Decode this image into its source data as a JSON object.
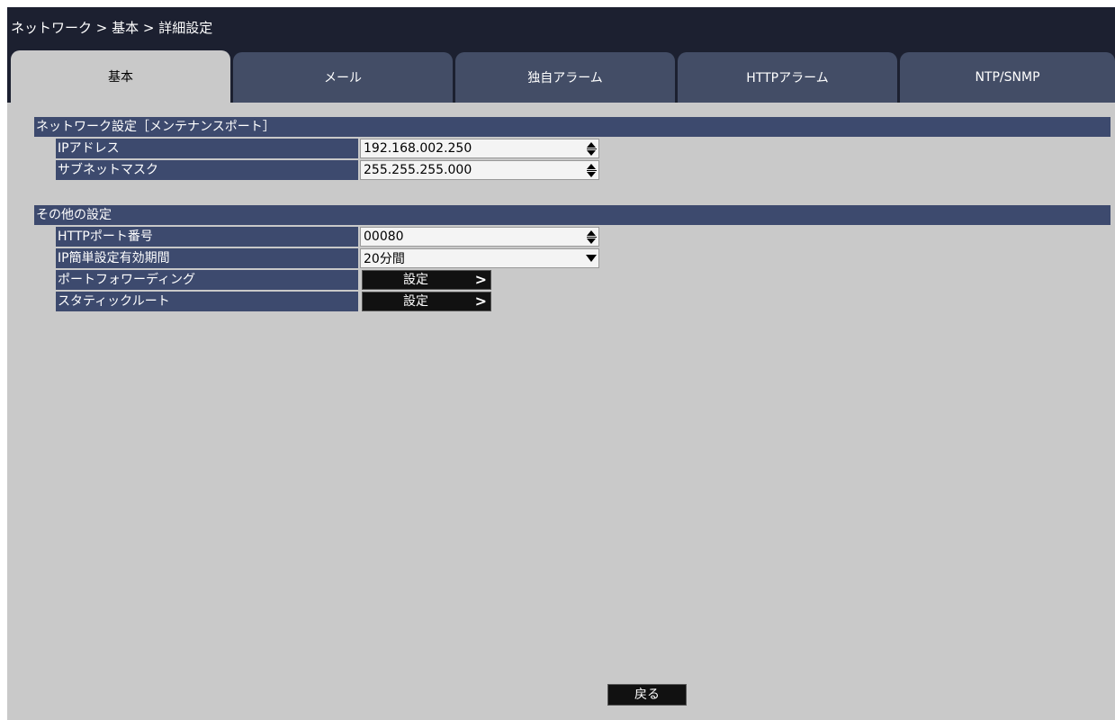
{
  "breadcrumb": "ネットワーク > 基本 > 詳細設定",
  "tabs": [
    {
      "label": "基本",
      "active": true
    },
    {
      "label": "メール",
      "active": false
    },
    {
      "label": "独自アラーム",
      "active": false
    },
    {
      "label": "HTTPアラーム",
      "active": false
    },
    {
      "label": "NTP/SNMP",
      "active": false
    }
  ],
  "network_section": {
    "title": "ネットワーク設定［メンテナンスポート］",
    "ip_address": {
      "label": "IPアドレス",
      "value": "192.168.002.250"
    },
    "subnet_mask": {
      "label": "サブネットマスク",
      "value": "255.255.255.000"
    }
  },
  "other_section": {
    "title": "その他の設定",
    "http_port": {
      "label": "HTTPポート番号",
      "value": "00080"
    },
    "ip_easy_setup": {
      "label": "IP簡単設定有効期間",
      "value": "20分間"
    },
    "port_forwarding": {
      "label": "ポートフォワーディング",
      "button": "設定",
      "chevron": ">"
    },
    "static_route": {
      "label": "スタティックルート",
      "button": "設定",
      "chevron": ">"
    }
  },
  "back_button": "戻る",
  "colors": {
    "title_bar": "#1c2030",
    "tab_inactive": "#434d66",
    "panel_background": "#c9c9c9",
    "label_background": "#3d4a6e",
    "button_background": "#111111"
  },
  "icons": {
    "spinner": "up-down-spinner-icon",
    "dropdown": "dropdown-arrow-icon",
    "chevron": "chevron-right-icon"
  }
}
